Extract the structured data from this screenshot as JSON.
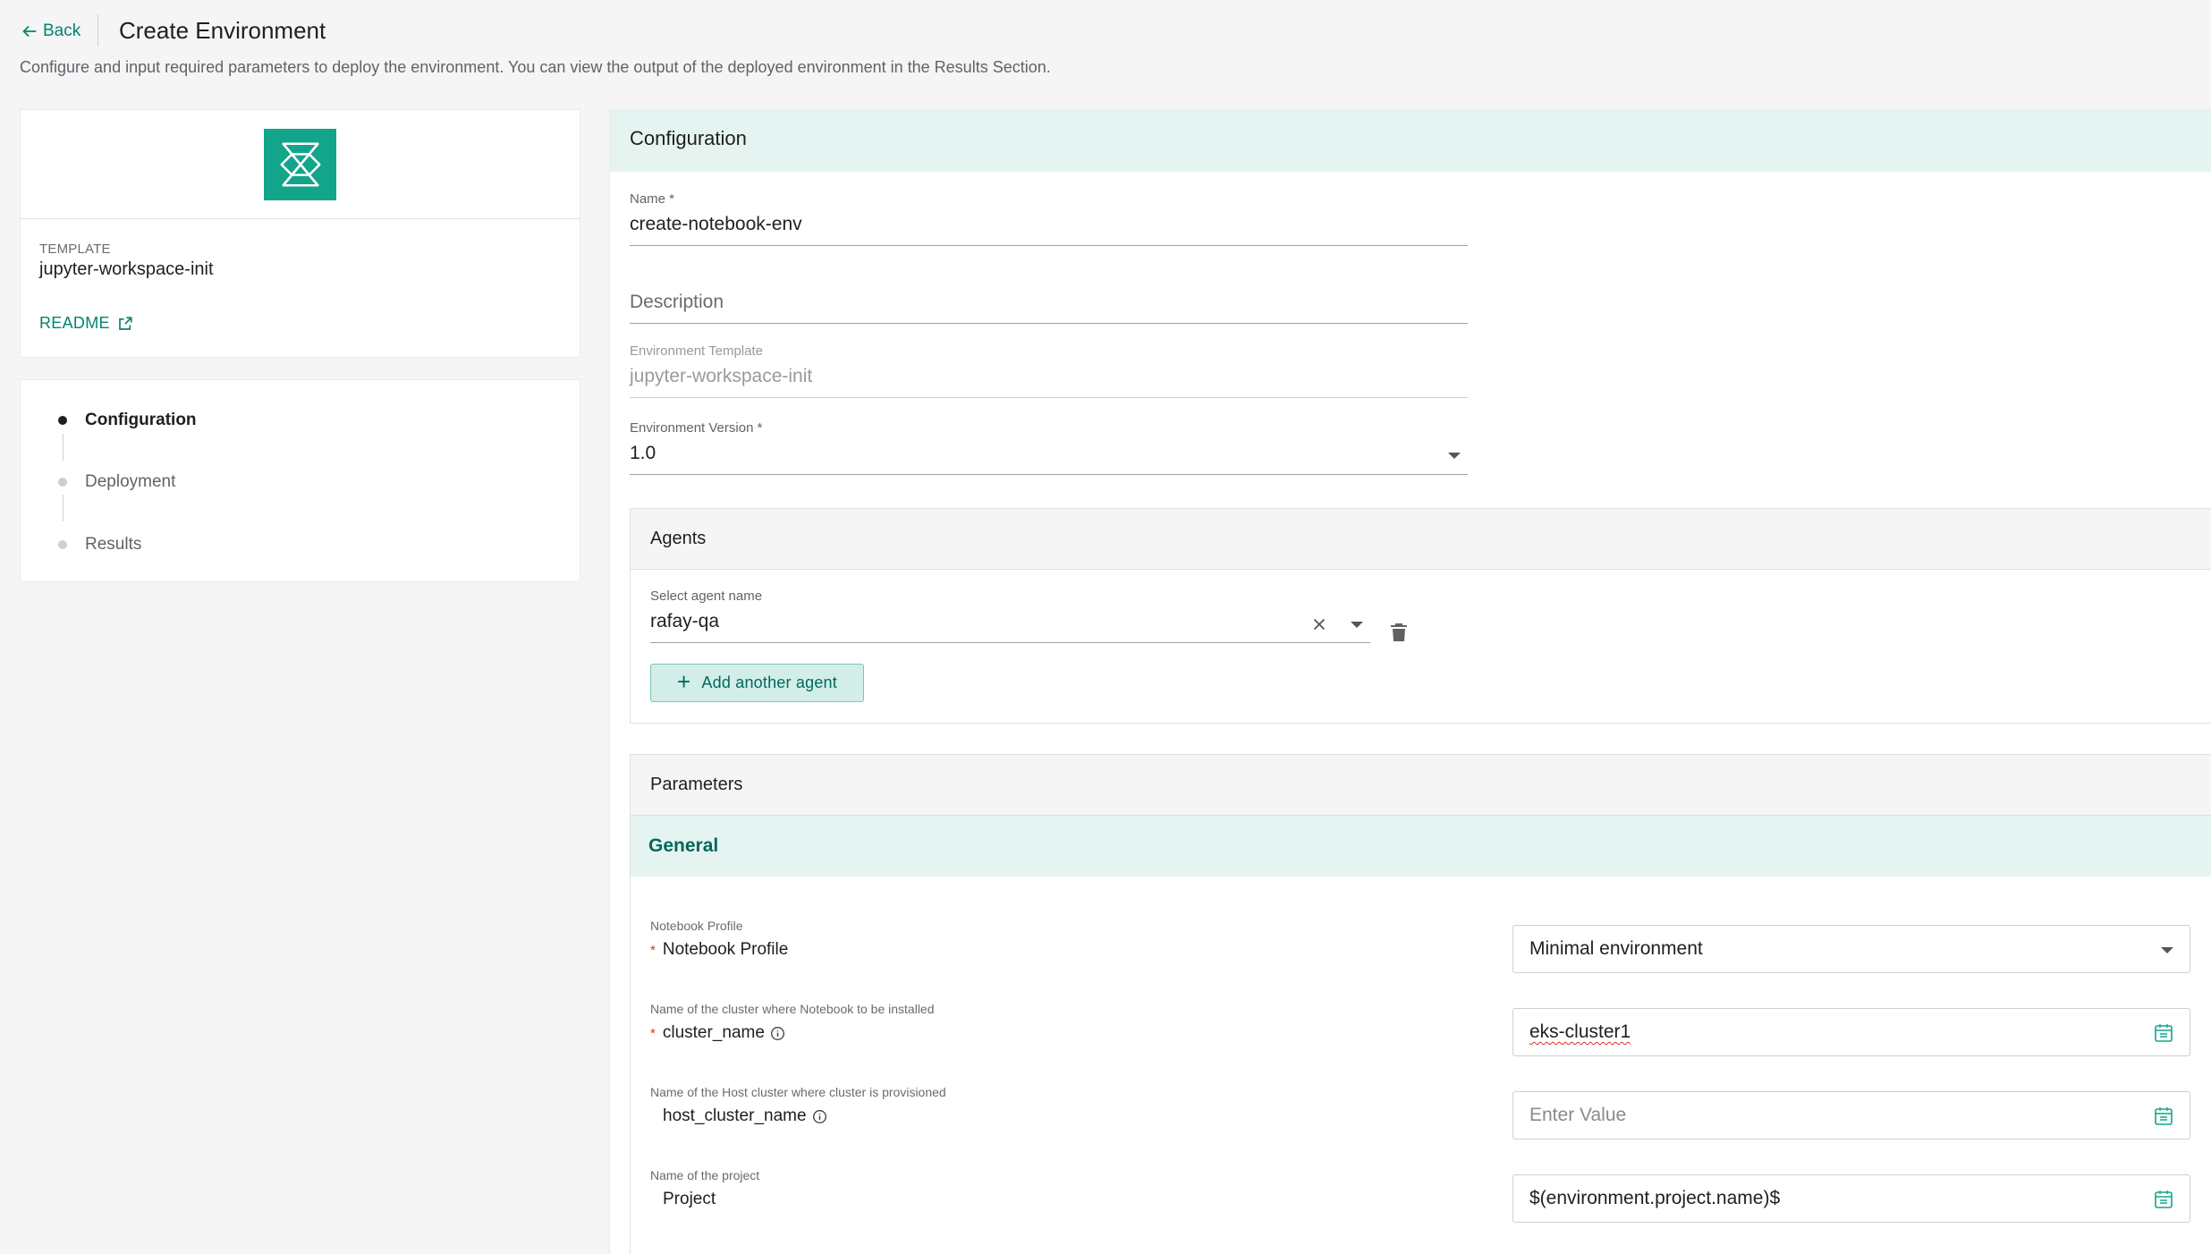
{
  "header": {
    "back_label": "Back",
    "title": "Create Environment",
    "description": "Configure and input required parameters to deploy the environment. You can view the output of the deployed environment in the Results Section."
  },
  "template_card": {
    "label": "TEMPLATE",
    "name": "jupyter-workspace-init",
    "readme_label": "README",
    "logo_color": "#13a58c"
  },
  "steps": [
    {
      "label": "Configuration",
      "active": true
    },
    {
      "label": "Deployment",
      "active": false
    },
    {
      "label": "Results",
      "active": false
    }
  ],
  "configuration": {
    "title": "Configuration",
    "name": {
      "label": "Name *",
      "value": "create-notebook-env"
    },
    "description": {
      "placeholder": "Description"
    },
    "environment_template": {
      "label": "Environment Template",
      "value": "jupyter-workspace-init"
    },
    "environment_version": {
      "label": "Environment Version *",
      "value": "1.0"
    }
  },
  "agents": {
    "title": "Agents",
    "select_label": "Select agent name",
    "selected": "rafay-qa",
    "add_button_label": "Add another agent"
  },
  "parameters": {
    "title": "Parameters",
    "group_title": "General",
    "rows": [
      {
        "description": "Notebook Profile",
        "name": "Notebook Profile",
        "required": true,
        "info": false,
        "value": "Minimal environment",
        "type": "select"
      },
      {
        "description": "Name of the cluster where Notebook to be installed",
        "name": "cluster_name",
        "required": true,
        "info": true,
        "value": "eks-cluster1",
        "type": "text"
      },
      {
        "description": "Name of the Host cluster where cluster is provisioned",
        "name": "host_cluster_name",
        "required": false,
        "info": true,
        "placeholder": "Enter Value",
        "type": "text"
      },
      {
        "description": "Name of the project",
        "name": "Project",
        "required": false,
        "info": false,
        "value": "$(environment.project.name)$",
        "type": "text"
      }
    ]
  },
  "colors": {
    "accent": "#00856f",
    "header_tint": "#e6f4f1",
    "button_bg": "#d3eee8",
    "required": "#d93025"
  }
}
